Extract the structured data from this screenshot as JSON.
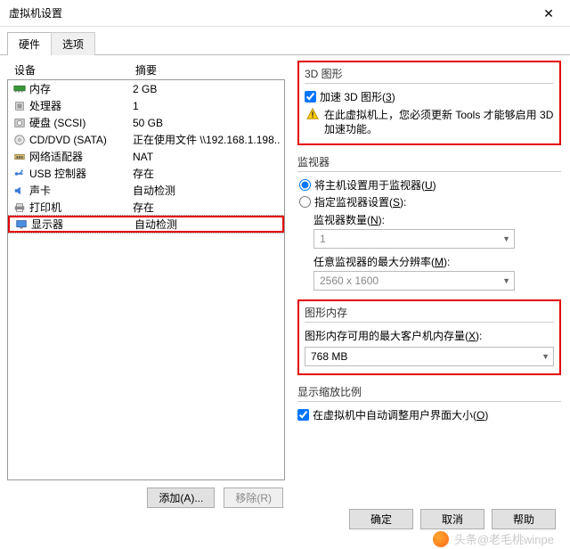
{
  "window": {
    "title": "虚拟机设置",
    "close": "✕"
  },
  "tabs": {
    "hardware": "硬件",
    "options": "选项"
  },
  "hwheader": {
    "device": "设备",
    "summary": "摘要"
  },
  "hw": [
    {
      "icon": "memory",
      "name": "内存",
      "summary": "2 GB"
    },
    {
      "icon": "cpu",
      "name": "处理器",
      "summary": "1"
    },
    {
      "icon": "disk",
      "name": "硬盘 (SCSI)",
      "summary": "50 GB"
    },
    {
      "icon": "cd",
      "name": "CD/DVD (SATA)",
      "summary": "正在使用文件 \\\\192.168.1.198..."
    },
    {
      "icon": "net",
      "name": "网络适配器",
      "summary": "NAT"
    },
    {
      "icon": "usb",
      "name": "USB 控制器",
      "summary": "存在"
    },
    {
      "icon": "sound",
      "name": "声卡",
      "summary": "自动检测"
    },
    {
      "icon": "printer",
      "name": "打印机",
      "summary": "存在"
    },
    {
      "icon": "display",
      "name": "显示器",
      "summary": "自动检测"
    }
  ],
  "leftbtns": {
    "add": "添加(A)...",
    "remove": "移除(R)"
  },
  "g3d": {
    "title": "3D 图形",
    "accel_label_pre": "加速 3D 图形(",
    "accel_key": "3",
    "accel_label_post": ")",
    "warn": "在此虚拟机上，您必须更新 Tools 才能够启用 3D 加速功能。"
  },
  "monitors": {
    "title": "监视器",
    "r1_pre": "将主机设置用于监视器(",
    "r1_key": "U",
    "r1_post": ")",
    "r2_pre": "指定监视器设置(",
    "r2_key": "S",
    "r2_post": "):",
    "count_label_pre": "监视器数量(",
    "count_key": "N",
    "count_label_post": "):",
    "count_value": "1",
    "maxres_label_pre": "任意监视器的最大分辨率(",
    "maxres_key": "M",
    "maxres_label_post": "):",
    "maxres_value": "2560 x 1600"
  },
  "gmem": {
    "title": "图形内存",
    "label_pre": "图形内存可用的最大客户机内存量(",
    "label_key": "X",
    "label_post": "):",
    "value": "768 MB"
  },
  "zoom": {
    "title": "显示缩放比例",
    "chk_pre": "在虚拟机中自动调整用户界面大小(",
    "chk_key": "O",
    "chk_post": ")"
  },
  "buttons": {
    "ok": "确定",
    "cancel": "取消",
    "help": "帮助"
  },
  "watermark": "头条@老毛桃winpe"
}
